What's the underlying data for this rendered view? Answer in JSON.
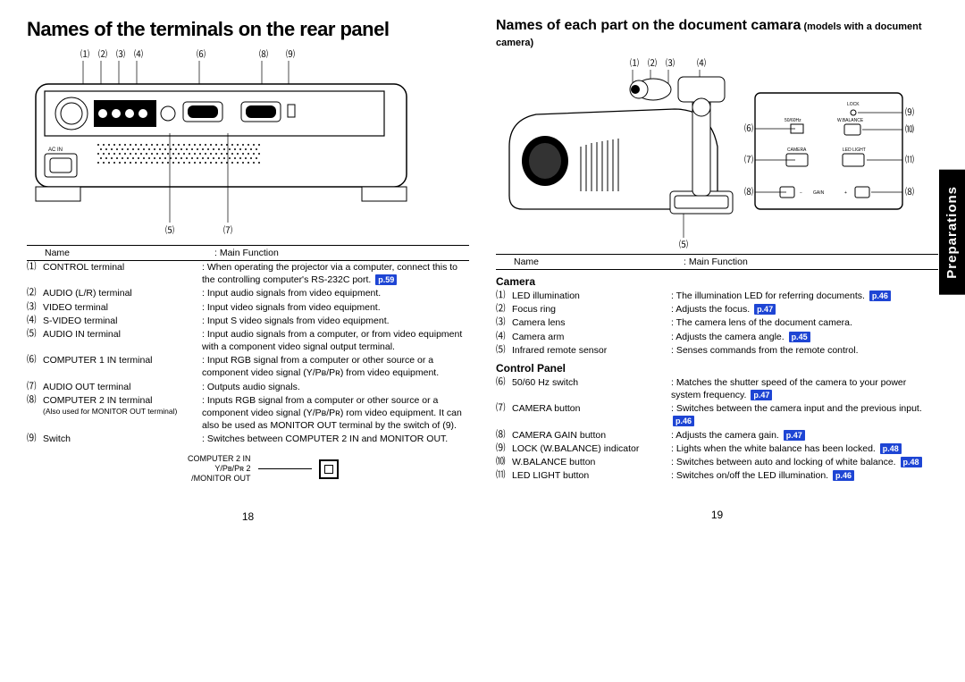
{
  "left": {
    "title": "Names of the terminals on the rear panel",
    "headers": {
      "name": "Name",
      "func": "Main Function"
    },
    "rows": [
      {
        "num": "⑴",
        "name": "CONTROL terminal",
        "func": "When operating the projector via a computer, connect this to the controlling computer's RS-232C port.",
        "pref": "p.59"
      },
      {
        "num": "⑵",
        "name": "AUDIO (L/R) terminal",
        "func": "Input audio signals from video equipment."
      },
      {
        "num": "⑶",
        "name": "VIDEO terminal",
        "func": "Input video signals from video equipment."
      },
      {
        "num": "⑷",
        "name": "S-VIDEO terminal",
        "func": "Input S video signals from video equipment."
      },
      {
        "num": "⑸",
        "name": "AUDIO IN terminal",
        "func": "Input audio signals from a computer, or from video equipment with a component video signal output terminal."
      },
      {
        "num": "⑹",
        "name": "COMPUTER 1 IN terminal",
        "func": "Input RGB signal from a computer or other source or a component video signal (Y/Pʙ/Pʀ) from video equipment."
      },
      {
        "num": "⑺",
        "name": "AUDIO OUT terminal",
        "func": "Outputs audio signals."
      },
      {
        "num": "⑻",
        "name": "COMPUTER 2 IN terminal",
        "alsonote": "(Also used for MONITOR OUT terminal)",
        "func": "Inputs RGB signal from a computer or other source or a component video signal (Y/Pʙ/Pʀ) rom video equipment. It can also be used as MONITOR OUT terminal by the switch of (9)."
      },
      {
        "num": "⑼",
        "name": "Switch",
        "func": "Switches between COMPUTER 2 IN and MONITOR OUT."
      }
    ],
    "subfig": {
      "l1": "COMPUTER 2 IN",
      "l2": "Y/Pʙ/Pʀ 2",
      "l3": "/MONITOR OUT"
    },
    "page": "18"
  },
  "right": {
    "title_main": "Names of each part on the document camara",
    "title_small": " (models with a document camera)",
    "headers": {
      "name": "Name",
      "func": "Main Function"
    },
    "section1": "Camera",
    "rows1": [
      {
        "num": "⑴",
        "name": "LED illumination",
        "func": "The illumination LED for referring documents.",
        "pref": "p.46"
      },
      {
        "num": "⑵",
        "name": "Focus ring",
        "func": "Adjusts the focus.",
        "pref": "p.47"
      },
      {
        "num": "⑶",
        "name": "Camera lens",
        "func": "The camera lens of the document camera."
      },
      {
        "num": "⑷",
        "name": "Camera arm",
        "func": "Adjusts the camera angle.",
        "pref": "p.45"
      },
      {
        "num": "⑸",
        "name": "Infrared remote sensor",
        "func": "Senses commands from the remote control."
      }
    ],
    "section2": "Control Panel",
    "rows2": [
      {
        "num": "⑹",
        "name": "50/60 Hz switch",
        "func": "Matches the shutter speed of the camera to your power system frequency.",
        "pref": "p.47"
      },
      {
        "num": "⑺",
        "name": "CAMERA button",
        "func": "Switches between the camera input and the previous input.",
        "pref": "p.46"
      },
      {
        "num": "⑻",
        "name": "CAMERA GAIN button",
        "func": "Adjusts the camera gain.",
        "pref": "p.47"
      },
      {
        "num": "⑼",
        "name": "LOCK (W.BALANCE) indicator",
        "func": "Lights when the white balance has been locked.",
        "pref": "p.48"
      },
      {
        "num": "⑽",
        "name": "W.BALANCE button",
        "func": "Switches between auto and locking of white balance.",
        "pref": "p.48"
      },
      {
        "num": "⑾",
        "name": "LED LIGHT button",
        "func": "Switches on/off the LED illumination.",
        "pref": "p.46"
      }
    ],
    "page": "19",
    "side": "Preparations",
    "panel": {
      "lock": "LOCK",
      "hz": "50/60Hz",
      "wb": "W.BALANCE",
      "cam": "CAMERA",
      "led": "LED LIGHT",
      "gain": "GAIN"
    },
    "diag": {
      "acin": "AC IN"
    }
  }
}
